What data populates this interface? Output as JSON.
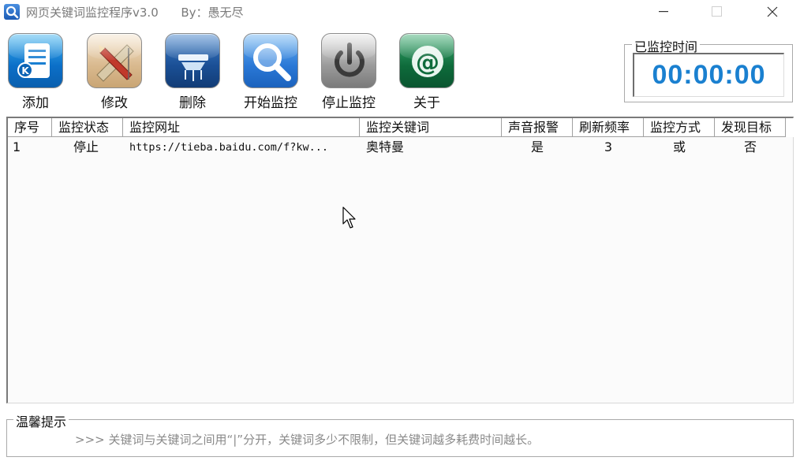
{
  "window": {
    "title": "网页关键词监控程序v3.0",
    "author": "By：愚无尽"
  },
  "toolbar": {
    "add": "添加",
    "edit": "修改",
    "delete": "删除",
    "start": "开始监控",
    "stop": "停止监控",
    "about": "关于"
  },
  "timer": {
    "label": "已监控时间",
    "value": "00:00:00"
  },
  "table": {
    "columns": [
      "序号",
      "监控状态",
      "监控网址",
      "监控关键词",
      "声音报警",
      "刷新频率",
      "监控方式",
      "发现目标"
    ],
    "rows": [
      [
        "1",
        "停止",
        "https://tieba.baidu.com/f?kw...",
        "奥特曼",
        "是",
        "3",
        "或",
        "否"
      ]
    ]
  },
  "tips": {
    "label": "温馨提示",
    "text": ">>> 关键词与关键词之间用“|”分开，关键词多少不限制，但关键词越多耗费时间越长。"
  },
  "colors": {
    "timer_digits": "#1a80d0"
  }
}
